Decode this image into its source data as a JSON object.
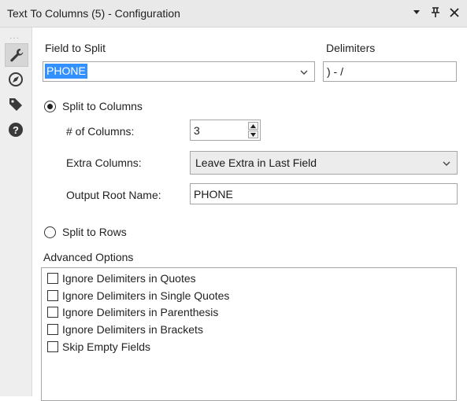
{
  "panel": {
    "title": "Text To Columns (5) - Configuration",
    "controls": [
      "dropdown-icon",
      "pin-icon",
      "close-icon"
    ]
  },
  "sidebar": {
    "icons": [
      "wrench-icon",
      "navigation-icon",
      "tag-icon",
      "help-icon"
    ],
    "active": "wrench-icon"
  },
  "config": {
    "field_to_split_label": "Field to Split",
    "field_to_split_value": "PHONE",
    "delimiters_label": "Delimiters",
    "delimiters_value": ") - /",
    "split_columns_label": "Split to Columns",
    "num_columns_label": "# of Columns:",
    "num_columns_value": "3",
    "extra_columns_label": "Extra Columns:",
    "extra_columns_value": "Leave Extra in Last Field",
    "output_root_label": "Output Root Name:",
    "output_root_value": "PHONE",
    "split_rows_label": "Split to Rows",
    "selected_mode": "Split to Columns"
  },
  "advanced": {
    "label": "Advanced Options",
    "options": [
      {
        "label": "Ignore Delimiters in Quotes",
        "checked": false
      },
      {
        "label": "Ignore Delimiters in Single Quotes",
        "checked": false
      },
      {
        "label": "Ignore Delimiters in Parenthesis",
        "checked": false
      },
      {
        "label": "Ignore Delimiters in Brackets",
        "checked": false
      },
      {
        "label": "Skip Empty Fields",
        "checked": false
      }
    ]
  },
  "colors": {
    "selection": "#3390ff",
    "titlebar": "#e9e9e9",
    "sidebar": "#eeeeee"
  }
}
